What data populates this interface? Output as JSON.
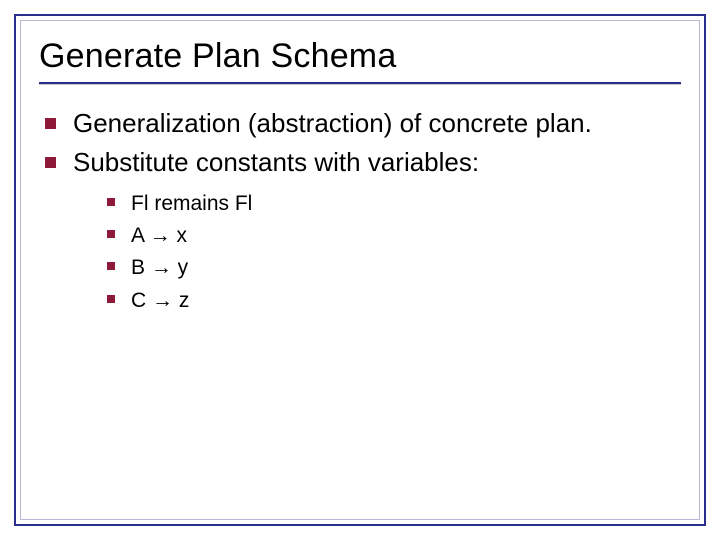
{
  "title": "Generate Plan Schema",
  "bullets": [
    {
      "text": "Generalization (abstraction) of concrete plan."
    },
    {
      "text": "Substitute constants with variables:"
    }
  ],
  "sub_bullets": [
    {
      "text": "Fl remains Fl"
    },
    {
      "text": "A → x"
    },
    {
      "text": "B → y"
    },
    {
      "text": "C → z"
    }
  ]
}
